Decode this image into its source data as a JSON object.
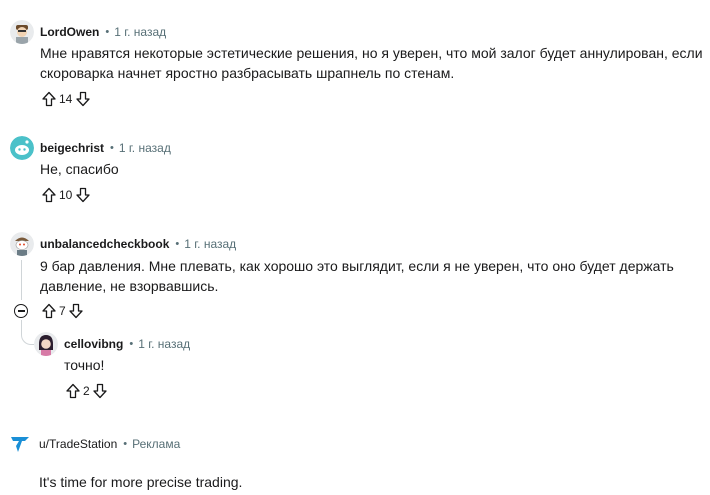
{
  "comments": [
    {
      "author": "LordOwen",
      "time": "1 г. назад",
      "text": "Мне нравятся некоторые эстетические решения, но я уверен, что мой залог будет аннулирован, если скороварка начнет яростно разбрасывать шрапнель по стенам.",
      "votes": "14"
    },
    {
      "author": "beigechrist",
      "time": "1 г. назад",
      "text": "Не, спасибо",
      "votes": "10"
    },
    {
      "author": "unbalancedcheckbook",
      "time": "1 г. назад",
      "text": "9 бар давления. Мне плевать, как хорошо это выглядит, если я не уверен, что оно будет держать давление, не взорвавшись.",
      "votes": "7"
    },
    {
      "author": "cellovibng",
      "time": "1 г. назад",
      "text": "точно!",
      "votes": "2"
    }
  ],
  "ad": {
    "advertiser": "u/TradeStation",
    "label": "Реклама",
    "text": "It's time for more precise trading."
  },
  "colors": {
    "text": "#1a1a1b",
    "meta": "#576f76",
    "thread_line": "#d0d5d8",
    "ad_brand": "#1a8fd6"
  }
}
